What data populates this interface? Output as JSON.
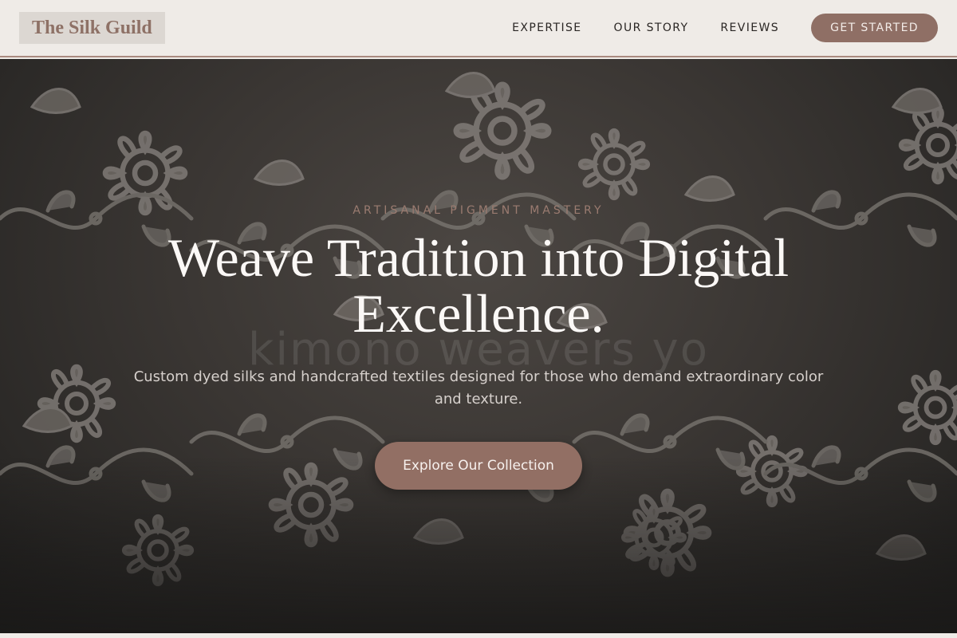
{
  "header": {
    "logo": "The Silk Guild",
    "nav": [
      {
        "label": "EXPERTISE"
      },
      {
        "label": "OUR STORY"
      },
      {
        "label": "REVIEWS"
      }
    ],
    "cta_label": "GET STARTED"
  },
  "hero": {
    "eyebrow": "ARTISANAL PIGMENT MASTERY",
    "title": "Weave Tradition into Digital Excellence.",
    "watermark": "kimono weavers yo",
    "subtitle": "Custom dyed silks and handcrafted textiles designed for those who demand extraordinary color and texture.",
    "button_label": "Explore Our Collection"
  },
  "colors": {
    "accent": "#8f6f65",
    "header_bg": "#efebe7",
    "hero_bg": "#3a3633",
    "eyebrow": "#9a7b70"
  },
  "icons": {
    "hero_background": "floral-damask-pattern"
  }
}
